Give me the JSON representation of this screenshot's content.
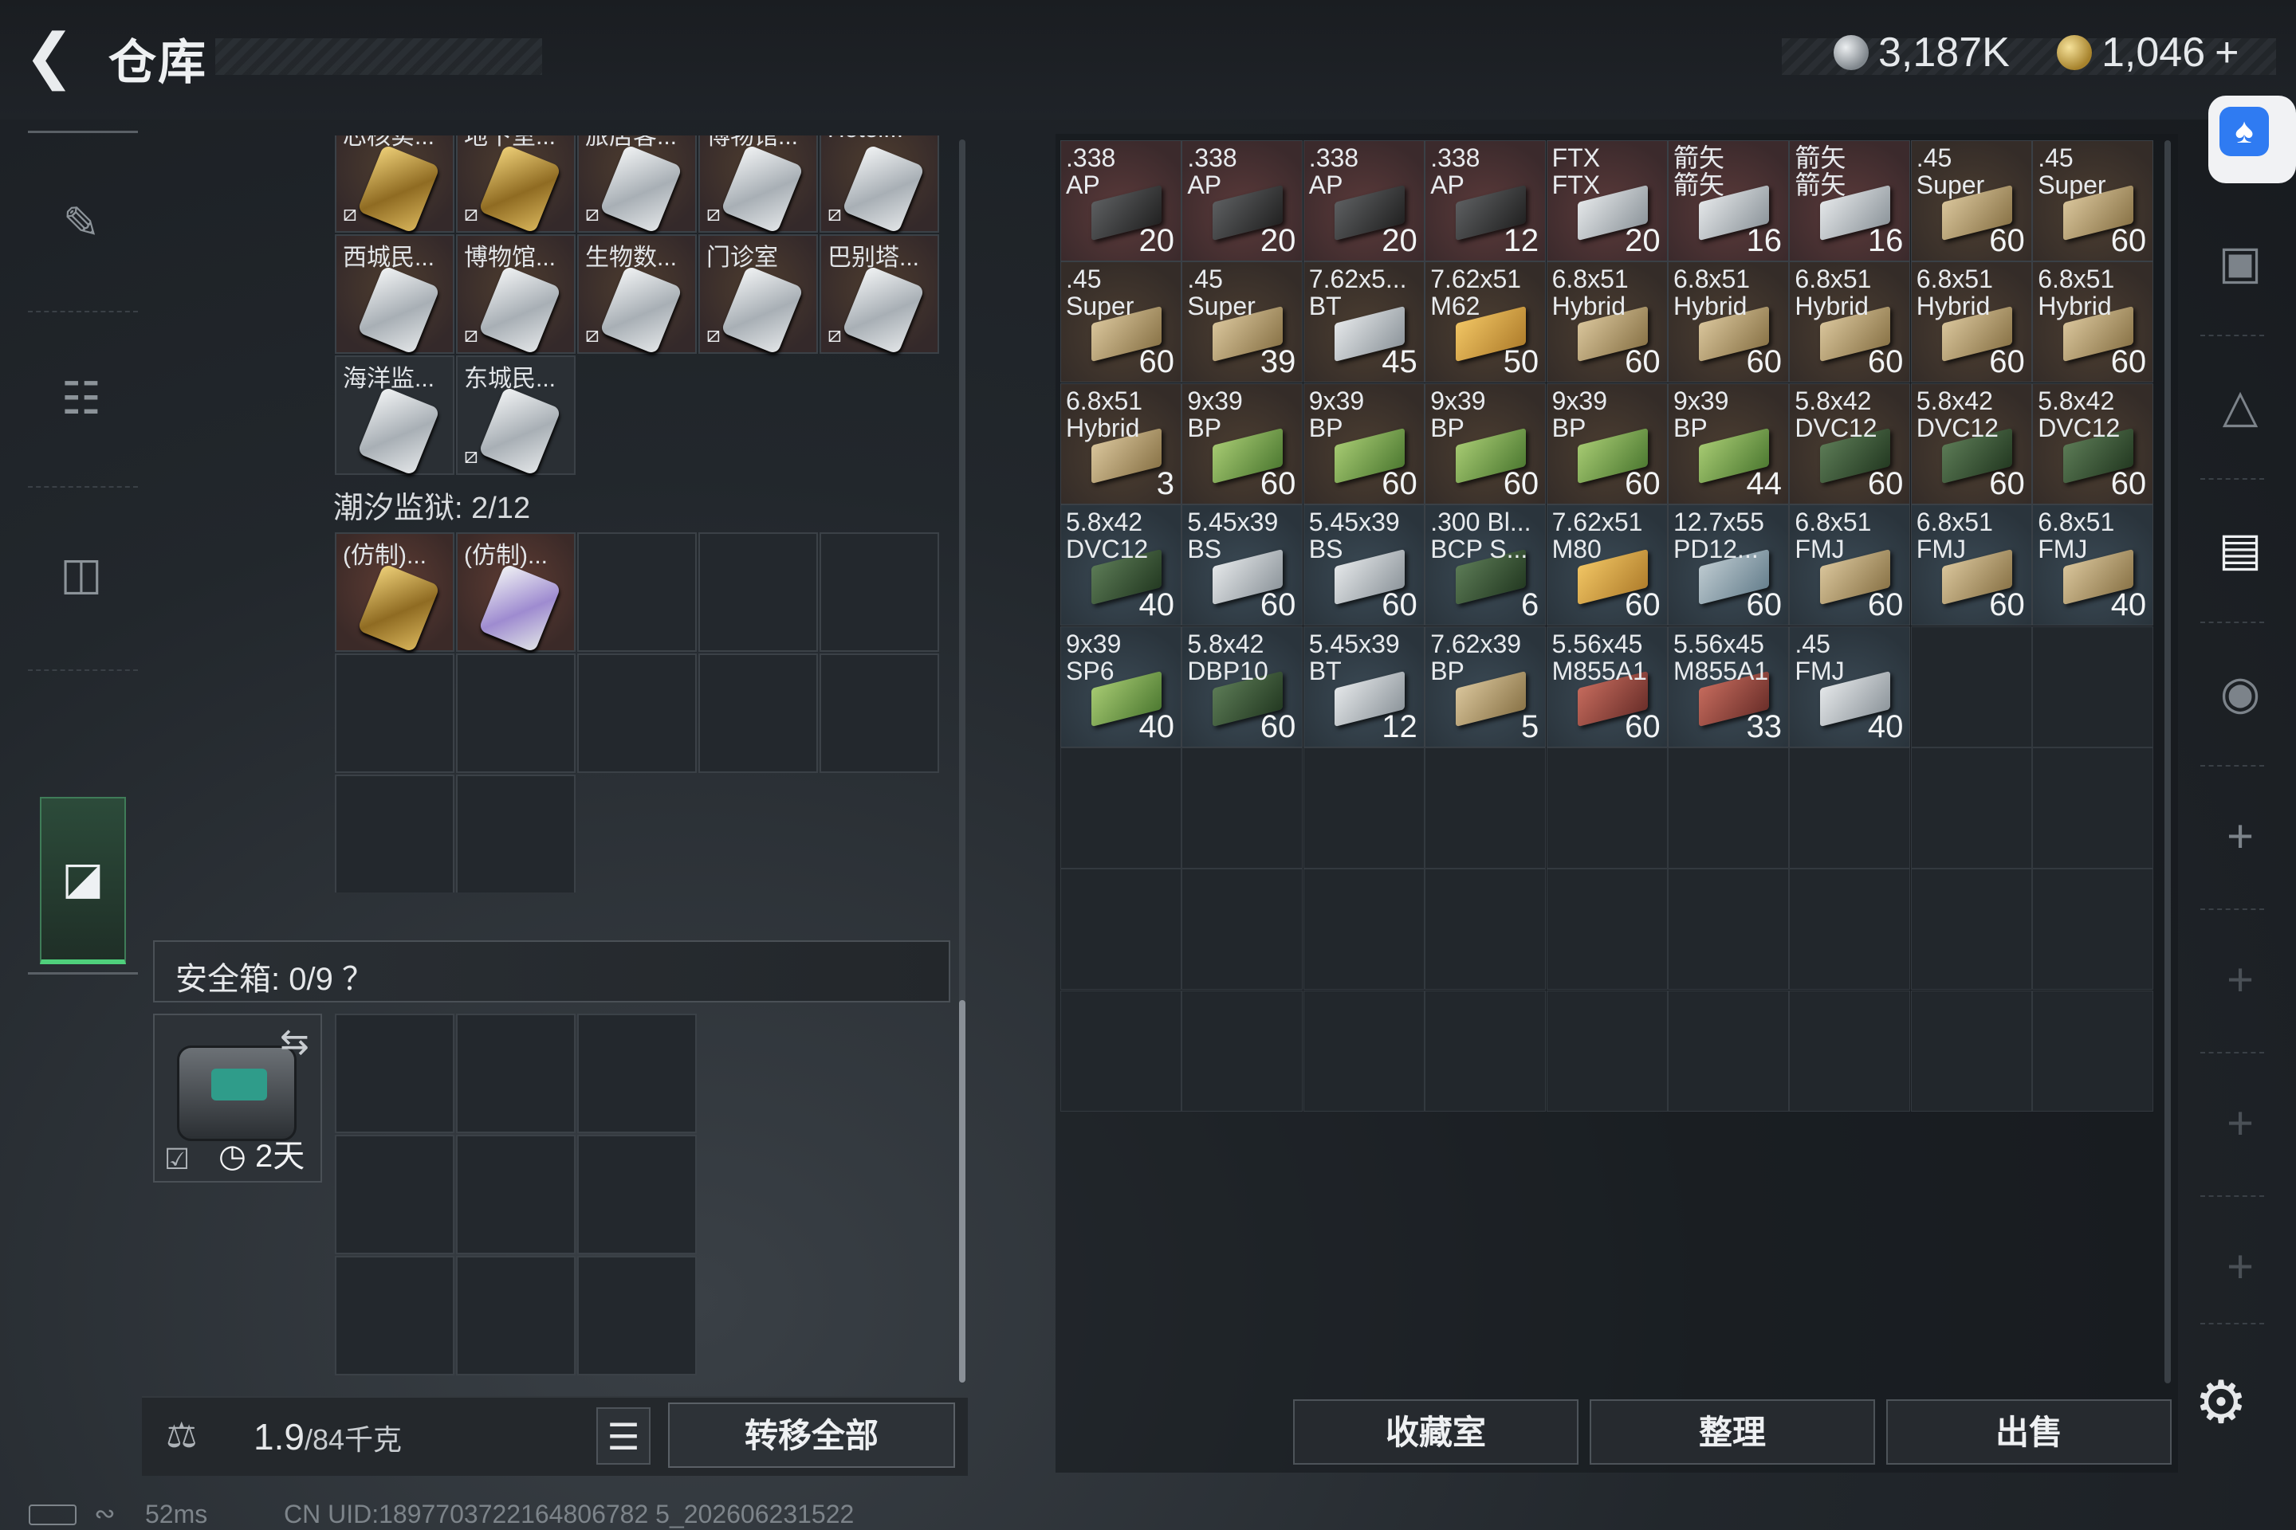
{
  "header": {
    "title": "仓库",
    "currency1": "3,187K",
    "currency2": "1,046",
    "plus": "+"
  },
  "stash": {
    "top_cards": [
      {
        "name": "芯核实...",
        "card": "gold",
        "locked": true
      },
      {
        "name": "地下室...",
        "card": "gold",
        "locked": true
      },
      {
        "name": "旅店客...",
        "card": "silver",
        "locked": true
      },
      {
        "name": "博物馆...",
        "card": "silver",
        "locked": true
      },
      {
        "name": "Hotel...",
        "card": "silver",
        "locked": true
      },
      {
        "name": "西城民...",
        "card": "silver",
        "locked": false
      },
      {
        "name": "博物馆...",
        "card": "silver",
        "locked": true
      },
      {
        "name": "生物数...",
        "card": "silver",
        "locked": true
      },
      {
        "name": "门诊室",
        "card": "silver",
        "locked": true
      },
      {
        "name": "巴别塔...",
        "card": "silver",
        "locked": true
      },
      {
        "name": "海洋监...",
        "card": "silver",
        "locked": false
      },
      {
        "name": "东城民...",
        "card": "silver",
        "locked": true
      }
    ],
    "section_label": "潮汐监狱: 2/12",
    "prison_cards": [
      {
        "name": "(仿制)...",
        "card": "gold"
      },
      {
        "name": "(仿制)...",
        "card": "purple"
      }
    ]
  },
  "safe": {
    "label": "安全箱: 0/9 ？",
    "days": "2天"
  },
  "weight": {
    "current": "1.9",
    "max": "/84千克"
  },
  "buttons": {
    "transfer_all": "转移全部",
    "collection": "收藏室",
    "organize": "整理",
    "sell": "出售"
  },
  "ammo": [
    {
      "name": ".338\nAP",
      "count": "20",
      "bg": "red",
      "box": "black"
    },
    {
      "name": ".338\nAP",
      "count": "20",
      "bg": "red",
      "box": "black"
    },
    {
      "name": ".338\nAP",
      "count": "20",
      "bg": "red",
      "box": "black"
    },
    {
      "name": ".338\nAP",
      "count": "12",
      "bg": "red",
      "box": "black"
    },
    {
      "name": "FTX\nFTX",
      "count": "20",
      "bg": "red",
      "box": "silver"
    },
    {
      "name": "箭矢\n箭矢",
      "count": "16",
      "bg": "red",
      "box": "silver"
    },
    {
      "name": "箭矢\n箭矢",
      "count": "16",
      "bg": "red",
      "box": "silver"
    },
    {
      "name": ".45\nSuper",
      "count": "60",
      "bg": "brown",
      "box": "tan"
    },
    {
      "name": ".45\nSuper",
      "count": "60",
      "bg": "brown",
      "box": "tan"
    },
    {
      "name": ".45\nSuper",
      "count": "60",
      "bg": "brown",
      "box": "tan"
    },
    {
      "name": ".45\nSuper",
      "count": "39",
      "bg": "brown",
      "box": "tan"
    },
    {
      "name": "7.62x5...\nBT",
      "count": "45",
      "bg": "brown",
      "box": "silver"
    },
    {
      "name": "7.62x51\nM62",
      "count": "50",
      "bg": "brown",
      "box": "gold"
    },
    {
      "name": "6.8x51\nHybrid",
      "count": "60",
      "bg": "brown",
      "box": "tan"
    },
    {
      "name": "6.8x51\nHybrid",
      "count": "60",
      "bg": "brown",
      "box": "tan"
    },
    {
      "name": "6.8x51\nHybrid",
      "count": "60",
      "bg": "brown",
      "box": "tan"
    },
    {
      "name": "6.8x51\nHybrid",
      "count": "60",
      "bg": "brown",
      "box": "tan"
    },
    {
      "name": "6.8x51\nHybrid",
      "count": "60",
      "bg": "brown",
      "box": "tan"
    },
    {
      "name": "6.8x51\nHybrid",
      "count": "3",
      "bg": "brown",
      "box": "tan"
    },
    {
      "name": "9x39\nBP",
      "count": "60",
      "bg": "brown",
      "box": "green"
    },
    {
      "name": "9x39\nBP",
      "count": "60",
      "bg": "brown",
      "box": "green"
    },
    {
      "name": "9x39\nBP",
      "count": "60",
      "bg": "brown",
      "box": "green"
    },
    {
      "name": "9x39\nBP",
      "count": "60",
      "bg": "brown",
      "box": "green"
    },
    {
      "name": "9x39\nBP",
      "count": "44",
      "bg": "brown",
      "box": "green"
    },
    {
      "name": "5.8x42\nDVC12",
      "count": "60",
      "bg": "brown",
      "box": "darkgreen"
    },
    {
      "name": "5.8x42\nDVC12",
      "count": "60",
      "bg": "brown",
      "box": "darkgreen"
    },
    {
      "name": "5.8x42\nDVC12",
      "count": "60",
      "bg": "brown",
      "box": "darkgreen"
    },
    {
      "name": "5.8x42\nDVC12",
      "count": "40",
      "bg": "blue",
      "box": "darkgreen"
    },
    {
      "name": "5.45x39\nBS",
      "count": "60",
      "bg": "blue",
      "box": "silver"
    },
    {
      "name": "5.45x39\nBS",
      "count": "60",
      "bg": "blue",
      "box": "silver"
    },
    {
      "name": ".300 Bl...\nBCP S...",
      "count": "6",
      "bg": "blue",
      "box": "darkgreen"
    },
    {
      "name": "7.62x51\nM80",
      "count": "60",
      "bg": "blue",
      "box": "gold"
    },
    {
      "name": "12.7x55\nPD12...",
      "count": "60",
      "bg": "blue",
      "box": "teal"
    },
    {
      "name": "6.8x51\nFMJ",
      "count": "60",
      "bg": "blue",
      "box": "tan"
    },
    {
      "name": "6.8x51\nFMJ",
      "count": "60",
      "bg": "blue",
      "box": "tan"
    },
    {
      "name": "6.8x51\nFMJ",
      "count": "40",
      "bg": "blue",
      "box": "tan"
    },
    {
      "name": "9x39\nSP6",
      "count": "40",
      "bg": "blue",
      "box": "green"
    },
    {
      "name": "5.8x42\nDBP10",
      "count": "60",
      "bg": "blue",
      "box": "darkgreen"
    },
    {
      "name": "5.45x39\nBT",
      "count": "12",
      "bg": "blue",
      "box": "silver"
    },
    {
      "name": "7.62x39\nBP",
      "count": "5",
      "bg": "blue",
      "box": "tan"
    },
    {
      "name": "5.56x45\nM855A1",
      "count": "60",
      "bg": "blue",
      "box": "red"
    },
    {
      "name": "5.56x45\nM855A1",
      "count": "33",
      "bg": "blue",
      "box": "red"
    },
    {
      "name": ".45\nFMJ",
      "count": "40",
      "bg": "blue",
      "box": "silver"
    }
  ],
  "status": {
    "ping": "52ms",
    "uid": "CN UID:1897703722164806782 5_202606231522"
  }
}
